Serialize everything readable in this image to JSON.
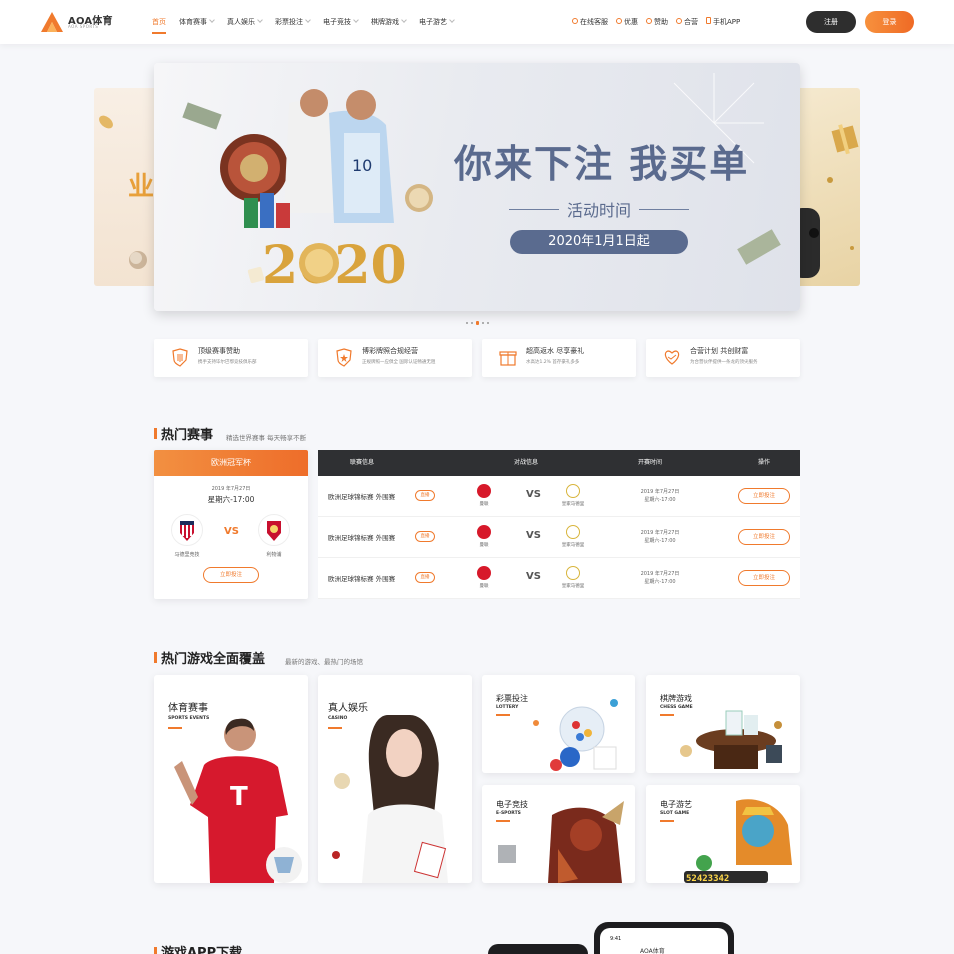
{
  "header": {
    "logo_title": "AOA体育",
    "logo_sub": "AOA SPORTS",
    "nav": [
      {
        "label": "首页",
        "active": true,
        "dropdown": false
      },
      {
        "label": "体育赛事",
        "active": false,
        "dropdown": true
      },
      {
        "label": "真人娱乐",
        "active": false,
        "dropdown": true
      },
      {
        "label": "彩票投注",
        "active": false,
        "dropdown": true
      },
      {
        "label": "电子竞技",
        "active": false,
        "dropdown": true
      },
      {
        "label": "棋牌游戏",
        "active": false,
        "dropdown": true
      },
      {
        "label": "电子游艺",
        "active": false,
        "dropdown": true
      }
    ],
    "utility": [
      {
        "label": "在线客服",
        "icon": "headset-icon"
      },
      {
        "label": "优惠",
        "icon": "gift-icon"
      },
      {
        "label": "赞助",
        "icon": "trophy-icon"
      },
      {
        "label": "合营",
        "icon": "handshake-icon"
      },
      {
        "label": "手机APP",
        "icon": "phone-icon"
      }
    ],
    "register": "注册",
    "login": "登录"
  },
  "banner": {
    "headline": "你来下注 我买单",
    "sub": "活动时间",
    "date": "2020年1月1日起",
    "year_art": "2020",
    "left_preview_text": "业"
  },
  "features": [
    {
      "title": "顶级赛事赞助",
      "desc": "携手支持毕尔巴鄂竞技俱乐部",
      "icon": "shield-club-icon"
    },
    {
      "title": "博彩牌照合规经营",
      "desc": "正规牌照一应俱全 国际认证畅通无阻",
      "icon": "shield-star-icon"
    },
    {
      "title": "超高返水 尽享豪礼",
      "desc": "水高达1.2% 首存豪礼多多",
      "icon": "gift-box-icon"
    },
    {
      "title": "合营计划 共创财富",
      "desc": "为合营伙伴提供一条龙的顶尖服务",
      "icon": "handshake-heart-icon"
    }
  ],
  "hot_matches": {
    "title": "热门赛事",
    "subtitle": "精选世界赛事 每天畅享不断",
    "featured": {
      "league": "欧洲冠军杯",
      "date": "2019 年7月27日",
      "time": "星期六-17:00",
      "home": "马德里竞技",
      "away": "利物浦",
      "vs": "VS",
      "bet": "立即投注"
    },
    "table": {
      "columns": [
        "联赛信息",
        "对战信息",
        "开赛时间",
        "操作"
      ],
      "rows": [
        {
          "league": "欧洲足球锦标赛 外围赛",
          "live": "直播",
          "home": "曼联",
          "away": "皇家马德里",
          "vs": "VS",
          "date": "2019 年7月27日",
          "time": "星期六-17:00",
          "bet": "立即投注"
        },
        {
          "league": "欧洲足球锦标赛 外围赛",
          "live": "直播",
          "home": "曼联",
          "away": "皇家马德里",
          "vs": "VS",
          "date": "2019 年7月27日",
          "time": "星期六-17:00",
          "bet": "立即投注"
        },
        {
          "league": "欧洲足球锦标赛 外围赛",
          "live": "直播",
          "home": "曼联",
          "away": "皇家马德里",
          "vs": "VS",
          "date": "2019 年7月27日",
          "time": "星期六-17:00",
          "bet": "立即投注"
        }
      ]
    }
  },
  "games": {
    "title": "热门游戏全面覆盖",
    "subtitle": "最新的游戏、最热门的场馆",
    "cards": [
      {
        "title": "体育赛事",
        "en": "SPORTS EVENTS"
      },
      {
        "title": "真人娱乐",
        "en": "CASINO"
      },
      {
        "title": "彩票投注",
        "en": "LOTTERY"
      },
      {
        "title": "棋牌游戏",
        "en": "CHESS GAME"
      },
      {
        "title": "电子竞技",
        "en": "E-SPORTS"
      },
      {
        "title": "电子游艺",
        "en": "SLOT GAME"
      }
    ],
    "slot_jackpot": "52423342"
  },
  "app_section": {
    "title": "游戏APP下载",
    "phone_brand": "AOA体育",
    "phone_time": "9:41"
  },
  "colors": {
    "accent": "#f07a2d",
    "dark": "#2e2e2e",
    "banner_text": "#5a6a8e"
  }
}
